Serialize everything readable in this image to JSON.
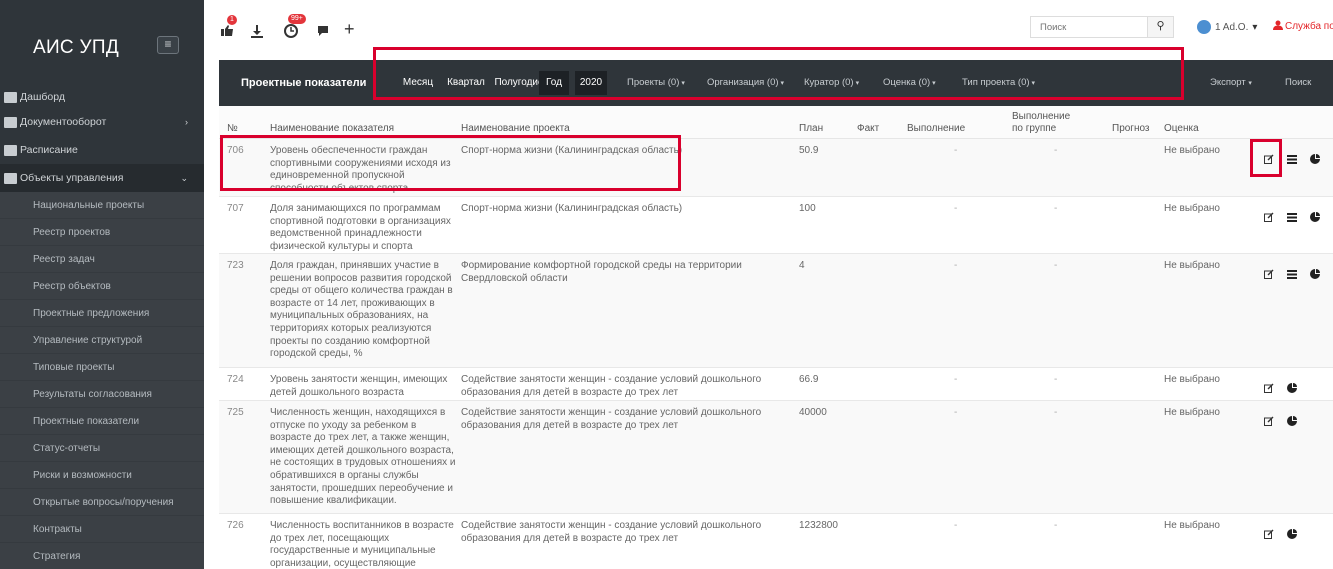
{
  "app": {
    "title": "АИС УПД",
    "toggle_glyph": "≡"
  },
  "sidebar": {
    "top_items": [
      {
        "label": "Дашборд",
        "icon": "dashboard-icon"
      },
      {
        "label": "Документооборот",
        "icon": "document-icon",
        "caret": "›"
      },
      {
        "label": "Расписание",
        "icon": "calendar-icon"
      },
      {
        "label": "Объекты управления",
        "icon": "briefcase-icon",
        "caret": "⌄"
      }
    ],
    "sub_items": [
      "Национальные проекты",
      "Реестр проектов",
      "Реестр задач",
      "Реестр объектов",
      "Проектные предложения",
      "Управление структурой",
      "Типовые проекты",
      "Результаты согласования",
      "Проектные показатели",
      "Статус-отчеты",
      "Риски и возможности",
      "Открытые вопросы/поручения",
      "Контракты",
      "Стратегия"
    ]
  },
  "toolbar": {
    "badge1": "1",
    "badge2": "99+",
    "plus": "+",
    "search_placeholder": "Поиск",
    "search_glyph": "⚲",
    "user": "1 Ad.O.",
    "user_caret": "▾",
    "support": "Служба поддер"
  },
  "filterbar": {
    "title": "Проектные показатели",
    "periods": [
      "Месяц",
      "Квартал",
      "Полугодие",
      "Год",
      "2020"
    ],
    "dropdowns": [
      "Проекты (0)",
      "Организация (0)",
      "Куратор (0)",
      "Оценка (0)",
      "Тип проекта (0)"
    ],
    "caret": "▾",
    "export": "Экспорт",
    "search": "Поиск"
  },
  "table": {
    "headers": {
      "num": "№",
      "name": "Наименование показателя",
      "project": "Наименование проекта",
      "plan": "План",
      "fact": "Факт",
      "exec": "Выполнение",
      "exec_group": "Выполнение по группе",
      "forecast": "Прогноз",
      "score": "Оценка"
    },
    "rows": [
      {
        "num": "706",
        "name": "Уровень обеспеченности граждан спортивными сооружениями исходя из единовременной пропускной способности объектов спорта",
        "project": "Спорт-норма жизни (Калининградская область)",
        "plan": "50.9",
        "exec": "-",
        "exec_group": "-",
        "score": "Не выбрано"
      },
      {
        "num": "707",
        "name": "Доля занимающихся по программам спортивной подготовки в организациях ведомственной принадлежности физической культуры и спорта",
        "project": "Спорт-норма жизни (Калининградская область)",
        "plan": "100",
        "exec": "-",
        "exec_group": "-",
        "score": "Не выбрано"
      },
      {
        "num": "723",
        "name": "Доля граждан, принявших участие в решении вопросов развития городской среды от общего количества граждан в возрасте от 14 лет, проживающих в муниципальных образованиях, на территориях которых реализуются проекты по созданию комфортной городской среды, %",
        "project": "Формирование комфортной городской среды на территории Свердловской области",
        "plan": "4",
        "exec": "-",
        "exec_group": "-",
        "score": "Не выбрано"
      },
      {
        "num": "724",
        "name": "Уровень занятости женщин, имеющих детей дошкольного возраста",
        "project": "Содействие занятости женщин - создание условий дошкольного образования для детей в возрасте до трех лет",
        "plan": "66.9",
        "exec": "-",
        "exec_group": "-",
        "score": "Не выбрано"
      },
      {
        "num": "725",
        "name": "Численность женщин, находящихся в отпуске по уходу за ребенком в возрасте до трех лет, а также женщин, имеющих детей дошкольного возраста, не состоящих в трудовых отношениях и обратившихся в органы службы занятости, прошедших переобучение и повышение квалификации.",
        "project": "Содействие занятости женщин - создание условий дошкольного образования для детей в возрасте до трех лет",
        "plan": "40000",
        "exec": "-",
        "exec_group": "-",
        "score": "Не выбрано"
      },
      {
        "num": "726",
        "name": "Численность воспитанников в возрасте до трех лет, посещающих государственные и муниципальные организации, осуществляющие образовательную",
        "project": "Содействие занятости женщин - создание условий дошкольного образования для детей в возрасте до трех лет",
        "plan": "1232800",
        "exec": "-",
        "exec_group": "-",
        "score": "Не выбрано"
      }
    ]
  },
  "colors": {
    "sidebar": "#2f353a",
    "highlight": "#d9002d",
    "badge": "#e3353b",
    "support": "#e3262a"
  }
}
